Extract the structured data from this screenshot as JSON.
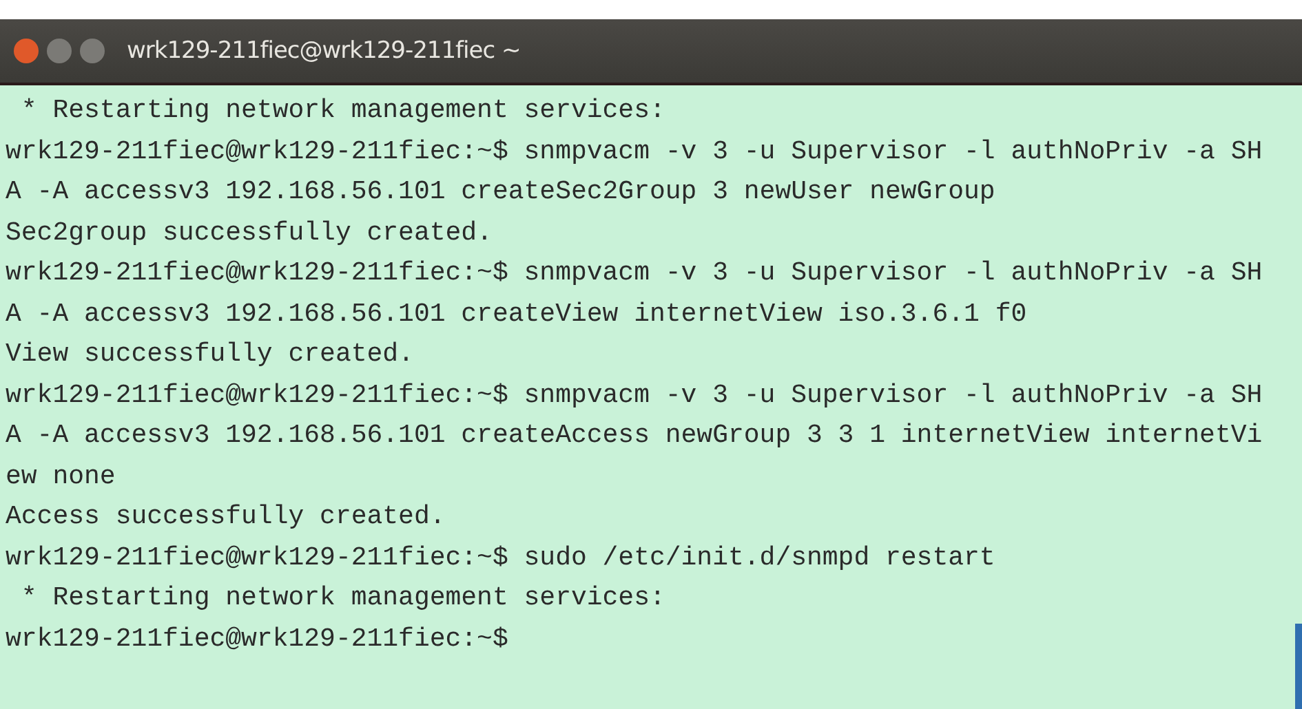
{
  "window": {
    "title": "wrk129-211fiec@wrk129-211fiec ~"
  },
  "terminal": {
    "lines": [
      " * Restarting network management services:",
      "wrk129-211fiec@wrk129-211fiec:~$ snmpvacm -v 3 -u Supervisor -l authNoPriv -a SH",
      "A -A accessv3 192.168.56.101 createSec2Group 3 newUser newGroup",
      "Sec2group successfully created.",
      "wrk129-211fiec@wrk129-211fiec:~$ snmpvacm -v 3 -u Supervisor -l authNoPriv -a SH",
      "A -A accessv3 192.168.56.101 createView internetView iso.3.6.1 f0",
      "View successfully created.",
      "wrk129-211fiec@wrk129-211fiec:~$ snmpvacm -v 3 -u Supervisor -l authNoPriv -a SH",
      "A -A accessv3 192.168.56.101 createAccess newGroup 3 3 1 internetView internetVi",
      "ew none",
      "Access successfully created.",
      "wrk129-211fiec@wrk129-211fiec:~$ sudo /etc/init.d/snmpd restart",
      " * Restarting network management services:",
      "wrk129-211fiec@wrk129-211fiec:~$"
    ]
  }
}
